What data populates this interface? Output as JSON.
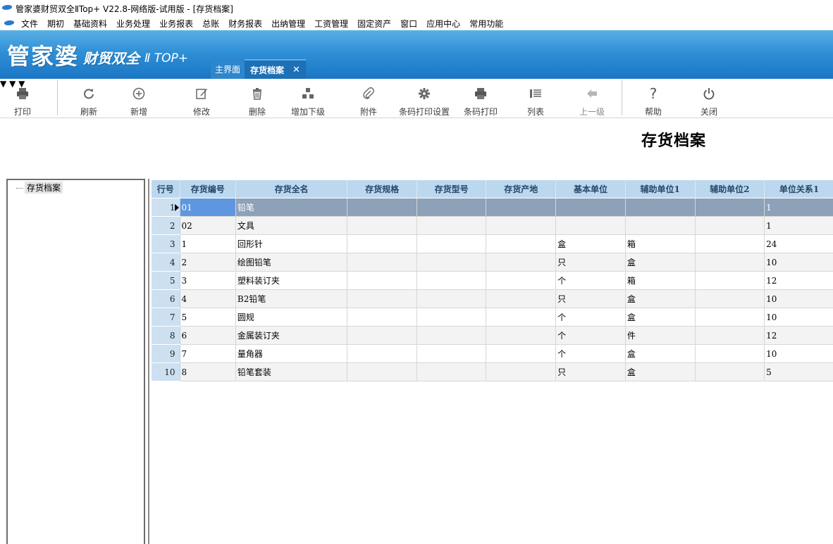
{
  "window": {
    "title": "管家婆财贸双全ⅡTop+ V22.8-网络版-试用版 - [存货档案]"
  },
  "menu": {
    "items": [
      "文件",
      "期初",
      "基础资料",
      "业务处理",
      "业务报表",
      "总账",
      "财务报表",
      "出纳管理",
      "工资管理",
      "固定资产",
      "窗口",
      "应用中心",
      "常用功能"
    ]
  },
  "banner": {
    "logo_main": "管家婆",
    "logo_sub": "财贸双全",
    "logo_edition": "Ⅱ TOP+"
  },
  "tabs": {
    "home_label": "主界面",
    "active_label": "存货档案",
    "close_glyph": "✕"
  },
  "toolbar": {
    "print": "打印",
    "refresh": "刷新",
    "add": "新增",
    "edit": "修改",
    "delete": "删除",
    "add_sub": "增加下级",
    "attachment": "附件",
    "barcode_settings": "条码打印设置",
    "barcode_print": "条码打印",
    "list": "列表",
    "up_level": "上一级",
    "help": "帮助",
    "close": "关闭"
  },
  "page": {
    "heading": "存货档案"
  },
  "tree": {
    "root_label": "存货档案"
  },
  "grid": {
    "columns": [
      "行号",
      "存货编号",
      "存货全名",
      "存货规格",
      "存货型号",
      "存货产地",
      "基本单位",
      "辅助单位1",
      "辅助单位2",
      "单位关系1"
    ],
    "rows": [
      [
        "1",
        "01",
        "铅笔",
        "",
        "",
        "",
        "",
        "",
        "",
        "1"
      ],
      [
        "2",
        "02",
        "文具",
        "",
        "",
        "",
        "",
        "",
        "",
        "1"
      ],
      [
        "3",
        "1",
        "回形针",
        "",
        "",
        "",
        "盒",
        "箱",
        "",
        "24"
      ],
      [
        "4",
        "2",
        "绘图铅笔",
        "",
        "",
        "",
        "只",
        "盒",
        "",
        "10"
      ],
      [
        "5",
        "3",
        "塑料装订夹",
        "",
        "",
        "",
        "个",
        "箱",
        "",
        "12"
      ],
      [
        "6",
        "4",
        "B2铅笔",
        "",
        "",
        "",
        "只",
        "盒",
        "",
        "10"
      ],
      [
        "7",
        "5",
        "圆规",
        "",
        "",
        "",
        "个",
        "盒",
        "",
        "10"
      ],
      [
        "8",
        "6",
        "金属装订夹",
        "",
        "",
        "",
        "个",
        "件",
        "",
        "12"
      ],
      [
        "9",
        "7",
        "量角器",
        "",
        "",
        "",
        "个",
        "盒",
        "",
        "10"
      ],
      [
        "10",
        "8",
        "铅笔套装",
        "",
        "",
        "",
        "只",
        "盒",
        "",
        "5"
      ]
    ]
  },
  "icons": {
    "print": "printer-icon",
    "refresh": "refresh-icon",
    "add": "plus-circle-icon",
    "edit": "pencil-icon",
    "delete": "trash-icon",
    "add_sub": "hierarchy-icon",
    "attachment": "paperclip-icon",
    "barcode_settings": "gear-icon",
    "barcode_print": "printer-icon",
    "list": "list-icon",
    "up_level": "arrow-left-icon",
    "help": "question-icon",
    "close": "power-icon"
  },
  "colors": {
    "banner": "#2f8fd6",
    "header_cell": "#bcd8ee",
    "selected_row": "#8da1b9",
    "selected_cell": "#5f96e0"
  }
}
